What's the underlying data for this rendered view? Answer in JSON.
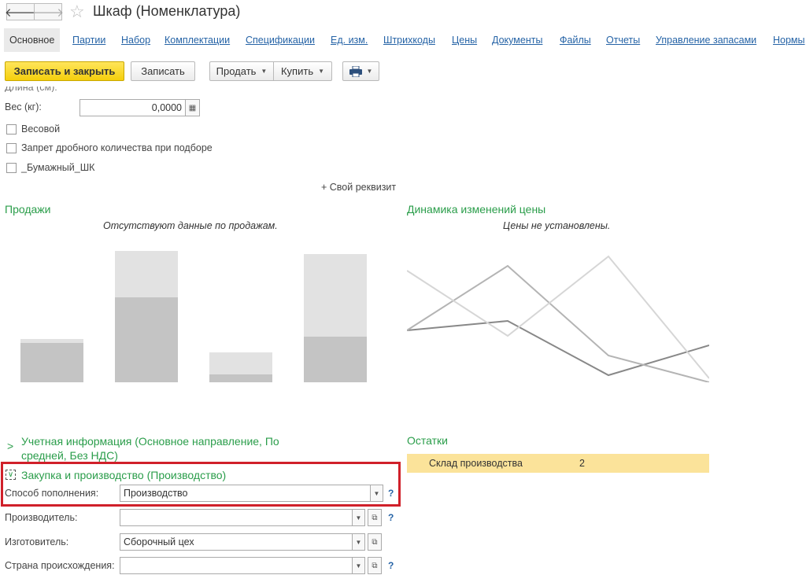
{
  "header": {
    "back_icon": "arrow-left-icon",
    "forward_icon": "arrow-right-icon",
    "star_icon": "star-icon",
    "title": "Шкаф (Номенклатура)"
  },
  "tabs": [
    "Основное",
    "Партии",
    "Набор",
    "Комплектации",
    "Спецификации",
    "Ед. изм.",
    "Штрихкоды",
    "Цены",
    "Документы",
    "Файлы",
    "Отчеты",
    "Управление запасами",
    "Нормы"
  ],
  "toolbar": {
    "save_close": "Записать и закрыть",
    "save": "Записать",
    "sell": "Продать",
    "buy": "Купить",
    "print_icon": "printer-icon"
  },
  "form": {
    "cut_label": "Длина (см):",
    "weight_label": "Вес (кг):",
    "weight_value": "0,0000",
    "checkboxes": [
      "Весовой",
      "Запрет дробного количества при подборе",
      "_Бумажный_ШК"
    ],
    "add_prop": "+ Свой реквизит"
  },
  "sales": {
    "title": "Продажи",
    "note": "Отсутствуют данные по продажам."
  },
  "prices": {
    "title": "Динамика изменений цены",
    "note": "Цены не установлены."
  },
  "chart_data": [
    {
      "type": "bar",
      "title": "Продажи",
      "categories": [
        "",
        "",
        "",
        ""
      ],
      "series": [
        {
          "values": [
            50,
            108,
            10,
            58
          ]
        },
        {
          "values": [
            5,
            59,
            28,
            105
          ]
        }
      ],
      "ylim": [
        0,
        170
      ],
      "colors": [
        "#c4c4c4",
        "#e2e2e2"
      ]
    },
    {
      "type": "line",
      "title": "Динамика изменений цены",
      "x": [
        0,
        1,
        2,
        3
      ],
      "series": [
        {
          "values": [
            66,
            78,
            9,
            47
          ],
          "color": "#888888"
        },
        {
          "values": [
            66,
            148,
            34,
            0
          ],
          "color": "#b4b4b4"
        },
        {
          "values": [
            142,
            59,
            160,
            5
          ],
          "color": "#d6d6d6"
        }
      ],
      "ylim": [
        0,
        170
      ]
    }
  ],
  "accounting": {
    "title": "Учетная информация (Основное направление, По средней, Без НДС)"
  },
  "purchase": {
    "title": "Закупка и производство (Производство)",
    "replenish_label": "Способ пополнения:",
    "replenish_value": "Производство",
    "producer_label": "Производитель:",
    "producer_value": "",
    "manufacturer_label": "Изготовитель:",
    "manufacturer_value": "Сборочный цех",
    "country_label": "Страна происхождения:",
    "country_value": "",
    "help": "?"
  },
  "stock": {
    "title": "Остатки",
    "warehouse": "Склад производства",
    "qty": "2"
  },
  "colors": {
    "accent_green": "#2a9d4a",
    "link_blue": "#2563a6",
    "highlight_red": "#d0202a",
    "stock_row": "#fbe39a"
  }
}
